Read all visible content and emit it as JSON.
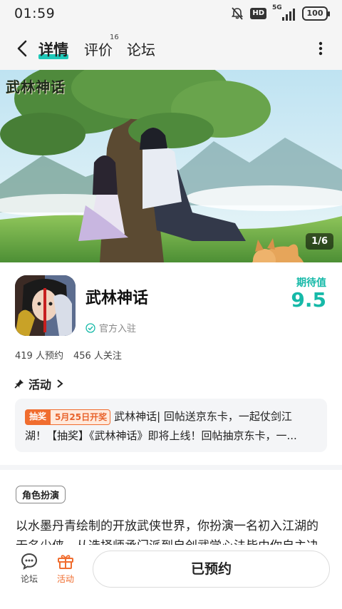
{
  "status_bar": {
    "time": "01:59",
    "icons": [
      "mute-bell-icon",
      "hd-icon",
      "5g-signal-icon",
      "battery-icon"
    ],
    "hd_label": "HD",
    "network_label": "5G",
    "battery": "100"
  },
  "nav": {
    "back_icon": "chevron-left-icon",
    "tabs": [
      {
        "label": "详情",
        "active": true
      },
      {
        "label": "评价",
        "count": "16"
      },
      {
        "label": "论坛"
      }
    ],
    "more_icon": "more-vertical-icon",
    "accent": "#1ec8b8"
  },
  "banner": {
    "logo_text": "武林神话",
    "pager": "1/6"
  },
  "game": {
    "title": "武林神话",
    "official_label": "官方入驻",
    "expect_label": "期待值",
    "expect_score": "9.5",
    "reservations": "419 人预约",
    "followers": "456 人关注",
    "score_color": "#16b9a8"
  },
  "activity": {
    "heading": "活动",
    "tag_type": "抽奖",
    "tag_date": "5月25日开奖",
    "line1": "武林神话| 回帖送京东卡，一起仗剑江",
    "line2": "湖！【抽奖】《武林神话》即将上线！回帖抽京东卡，一...",
    "accent": "#f06d2f"
  },
  "genre_tag": "角色扮演",
  "description": "以水墨丹青绘制的开放武侠世界，你扮演一名初入江湖的无名少侠，从选择师承门派到自创武学心法皆由你自主决定，在風",
  "bottom_bar": {
    "forum_label": "论坛",
    "activity_label": "活动",
    "reserve_label": "已预约"
  }
}
